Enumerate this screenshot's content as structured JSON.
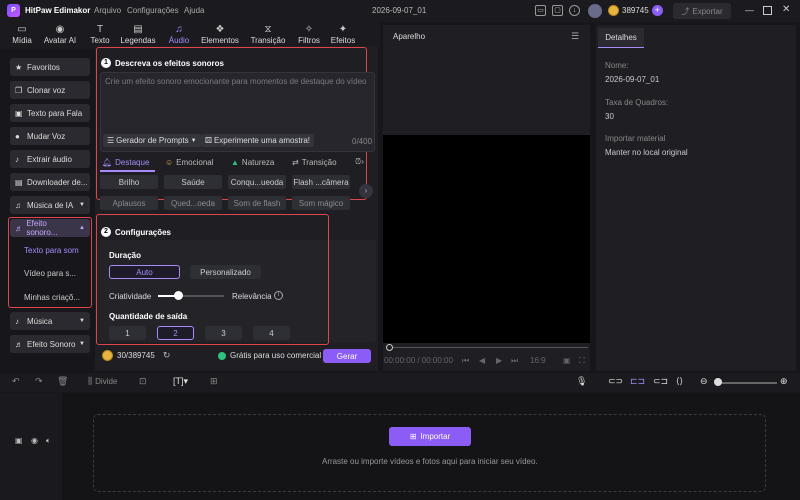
{
  "app": {
    "name": "HitPaw Edimakor",
    "menu": [
      "Arquivo",
      "Configurações",
      "Ajuda"
    ],
    "window_title": "2026-09-07_01",
    "credits": "389745",
    "export_label": "Exportar"
  },
  "tabs": [
    {
      "label": "Mídia",
      "icon": "folder-icon"
    },
    {
      "label": "Avatar AI",
      "icon": "avatar-icon"
    },
    {
      "label": "Texto",
      "icon": "text-icon"
    },
    {
      "label": "Legendas",
      "icon": "subtitle-icon"
    },
    {
      "label": "Áudio",
      "icon": "music-note-icon",
      "active": true
    },
    {
      "label": "Elementos",
      "icon": "elements-icon"
    },
    {
      "label": "Transição",
      "icon": "transition-icon"
    },
    {
      "label": "Filtros",
      "icon": "filter-icon"
    },
    {
      "label": "Efeitos",
      "icon": "effects-icon"
    }
  ],
  "sidebar": {
    "items": [
      {
        "label": "Favoritos",
        "icon": "star-icon"
      },
      {
        "label": "Clonar voz",
        "icon": "copy-icon"
      },
      {
        "label": "Texto para Fala",
        "icon": "tts-icon"
      },
      {
        "label": "Mudar Voz",
        "icon": "mic-icon"
      },
      {
        "label": "Extrair áudio",
        "icon": "extract-icon"
      },
      {
        "label": "Downloader de...",
        "icon": "download-icon"
      },
      {
        "label": "Música de IA",
        "icon": "ai-music-icon"
      }
    ],
    "sound_effect_group": {
      "label": "Efeito sonoro...",
      "subitems": [
        "Texto para som",
        "Vídeo para s...",
        "Minhas criaçõ..."
      ]
    },
    "bottom_items": [
      {
        "label": "Música",
        "icon": "music-icon"
      },
      {
        "label": "Efeito Sonoro",
        "icon": "sound-effect-icon"
      }
    ]
  },
  "describe": {
    "number": "1",
    "title": "Descreva os efeitos sonoros",
    "placeholder": "Crie um efeito sonoro emocionante para momentos de destaque do vídeo",
    "prompt_generator": "Gerador de Prompts",
    "try_sample": "Experimente uma amostra!",
    "counter": "0/400",
    "categories": [
      "Destaque",
      "Emocional",
      "Natureza",
      "Transição"
    ],
    "tags_row1": [
      "Brilho",
      "Saúde",
      "Conqu...ueoda",
      "Flash ...câmera"
    ],
    "tags_row2": [
      "Aplausos",
      "Qued...oeda",
      "Som de flash",
      "Som mágico"
    ]
  },
  "config": {
    "number": "2",
    "title": "Configurações",
    "duration_label": "Duração",
    "duration_options": [
      "Auto",
      "Personalizado"
    ],
    "creativity_label": "Criatividade",
    "relevance_label": "Relevância",
    "slider_value": 0.3,
    "output_label": "Quantidade de saída",
    "output_options": [
      "1",
      "2",
      "3",
      "4"
    ],
    "output_selected": "2"
  },
  "footer": {
    "credits": "30/389745",
    "commercial": "Grátis para uso comercial",
    "generate": "Gerar"
  },
  "preview": {
    "title": "Aparelho",
    "time": "00:00:00 / 00:00:00",
    "ratio": "16:9"
  },
  "details": {
    "tab": "Detalhes",
    "name_label": "Nome:",
    "name_value": "2026-09-07_01",
    "fps_label": "Taxa de Quadros:",
    "fps_value": "30",
    "import_label": "Importar material",
    "import_value": "Manter no local original"
  },
  "timeline": {
    "split_label": "Divide",
    "import_button": "Importar",
    "drop_hint": "Arraste ou importe vídeos e fotos aqui para iniciar seu vídeo."
  },
  "colors": {
    "accent": "#8b5cf6",
    "highlight_box": "#e0454c"
  }
}
